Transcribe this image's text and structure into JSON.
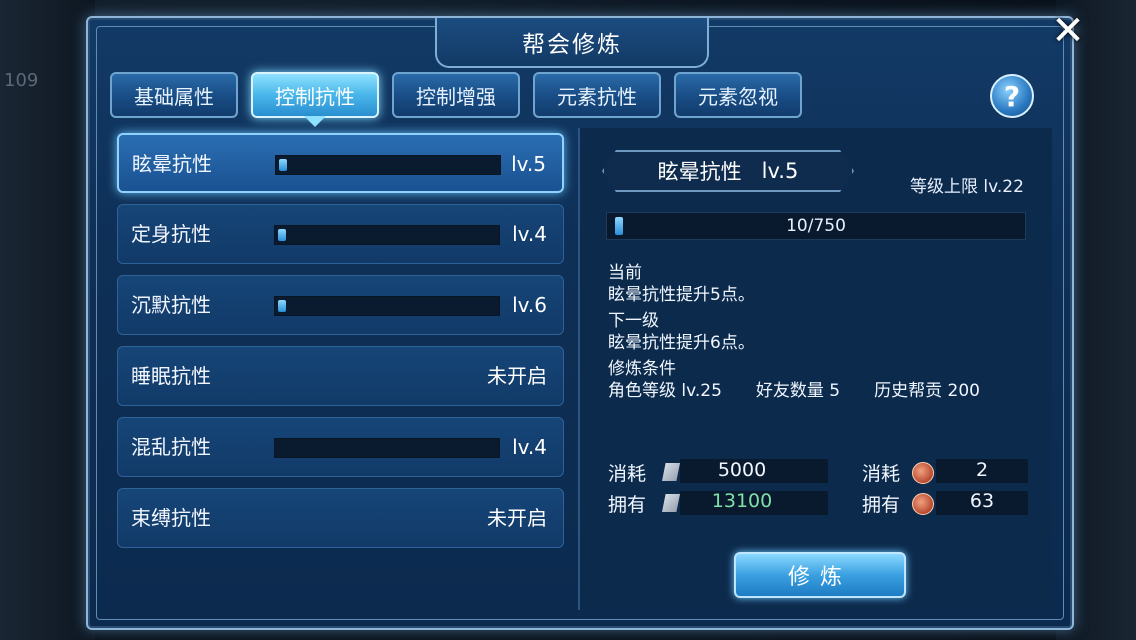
{
  "window": {
    "title": "帮会修炼",
    "close_symbol": "✕"
  },
  "tabs": [
    {
      "label": "基础属性",
      "active": false
    },
    {
      "label": "控制抗性",
      "active": true
    },
    {
      "label": "控制增强",
      "active": false
    },
    {
      "label": "元素抗性",
      "active": false
    },
    {
      "label": "元素忽视",
      "active": false
    }
  ],
  "help": {
    "symbol": "?"
  },
  "list": [
    {
      "name": "眩晕抗性",
      "level": "lv.5",
      "progress": 0.013,
      "selected": true
    },
    {
      "name": "定身抗性",
      "level": "lv.4",
      "progress": 0.013,
      "selected": false
    },
    {
      "name": "沉默抗性",
      "level": "lv.6",
      "progress": 0.013,
      "selected": false
    },
    {
      "name": "睡眠抗性",
      "level": "未开启",
      "progress": null,
      "selected": false
    },
    {
      "name": "混乱抗性",
      "level": "lv.4",
      "progress": 0.0,
      "selected": false
    },
    {
      "name": "束缚抗性",
      "level": "未开启",
      "progress": null,
      "selected": false
    }
  ],
  "detail": {
    "name": "眩晕抗性",
    "level": "lv.5",
    "level_cap": "等级上限 lv.22",
    "exp_text": "10/750",
    "exp_progress": 0.013,
    "current_label": "当前",
    "current_effect": "眩晕抗性提升5点。",
    "next_label": "下一级",
    "next_effect": "眩晕抗性提升6点。",
    "condition_label": "修炼条件",
    "conditions": "角色等级 lv.25　　好友数量 5　　历史帮贡 200"
  },
  "costs": {
    "consume_label": "消耗",
    "own_label": "拥有",
    "paper_consume": "5000",
    "paper_own": "13100",
    "coin_consume": "2",
    "coin_own": "63",
    "paper_own_color": "#7fe0a8"
  },
  "button": {
    "label": "修炼"
  },
  "background": {
    "left_number": "109"
  }
}
